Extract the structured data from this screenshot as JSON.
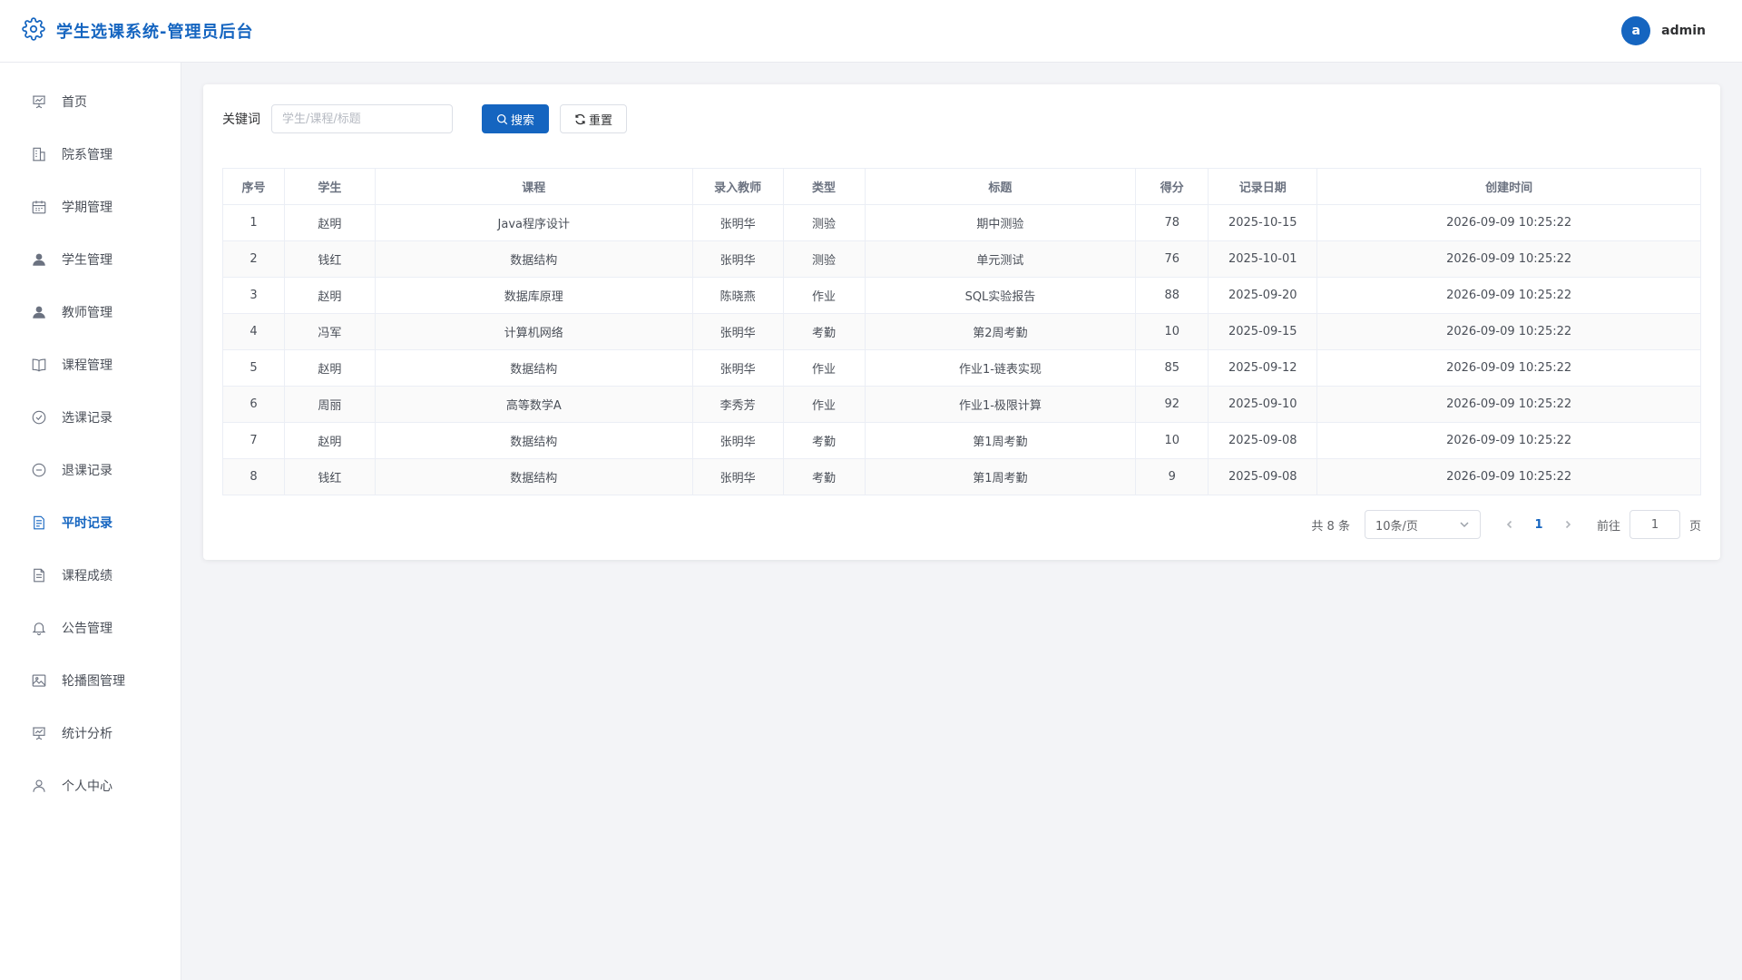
{
  "header": {
    "title": "学生选课系统-管理员后台",
    "avatar_letter": "a",
    "username": "admin"
  },
  "sidebar": {
    "items": [
      {
        "label": "首页",
        "icon": "presentation-icon",
        "active": false
      },
      {
        "label": "院系管理",
        "icon": "building-icon",
        "active": false
      },
      {
        "label": "学期管理",
        "icon": "calendar-icon",
        "active": false
      },
      {
        "label": "学生管理",
        "icon": "user-filled-icon",
        "active": false
      },
      {
        "label": "教师管理",
        "icon": "user-filled-icon",
        "active": false
      },
      {
        "label": "课程管理",
        "icon": "book-icon",
        "active": false
      },
      {
        "label": "选课记录",
        "icon": "circle-check-icon",
        "active": false
      },
      {
        "label": "退课记录",
        "icon": "circle-minus-icon",
        "active": false
      },
      {
        "label": "平时记录",
        "icon": "document-icon",
        "active": true
      },
      {
        "label": "课程成绩",
        "icon": "document-icon",
        "active": false
      },
      {
        "label": "公告管理",
        "icon": "bell-icon",
        "active": false
      },
      {
        "label": "轮播图管理",
        "icon": "picture-icon",
        "active": false
      },
      {
        "label": "统计分析",
        "icon": "presentation-icon",
        "active": false
      },
      {
        "label": "个人中心",
        "icon": "user-outline-icon",
        "active": false
      }
    ]
  },
  "search": {
    "label": "关键词",
    "placeholder": "学生/课程/标题",
    "value": "",
    "search_button": "搜索",
    "reset_button": "重置"
  },
  "table": {
    "columns": [
      "序号",
      "学生",
      "课程",
      "录入教师",
      "类型",
      "标题",
      "得分",
      "记录日期",
      "创建时间"
    ],
    "rows": [
      [
        "1",
        "赵明",
        "Java程序设计",
        "张明华",
        "测验",
        "期中测验",
        "78",
        "2025-10-15",
        "2026-09-09 10:25:22"
      ],
      [
        "2",
        "钱红",
        "数据结构",
        "张明华",
        "测验",
        "单元测试",
        "76",
        "2025-10-01",
        "2026-09-09 10:25:22"
      ],
      [
        "3",
        "赵明",
        "数据库原理",
        "陈晓燕",
        "作业",
        "SQL实验报告",
        "88",
        "2025-09-20",
        "2026-09-09 10:25:22"
      ],
      [
        "4",
        "冯军",
        "计算机网络",
        "张明华",
        "考勤",
        "第2周考勤",
        "10",
        "2025-09-15",
        "2026-09-09 10:25:22"
      ],
      [
        "5",
        "赵明",
        "数据结构",
        "张明华",
        "作业",
        "作业1-链表实现",
        "85",
        "2025-09-12",
        "2026-09-09 10:25:22"
      ],
      [
        "6",
        "周丽",
        "高等数学A",
        "李秀芳",
        "作业",
        "作业1-极限计算",
        "92",
        "2025-09-10",
        "2026-09-09 10:25:22"
      ],
      [
        "7",
        "赵明",
        "数据结构",
        "张明华",
        "考勤",
        "第1周考勤",
        "10",
        "2025-09-08",
        "2026-09-09 10:25:22"
      ],
      [
        "8",
        "钱红",
        "数据结构",
        "张明华",
        "考勤",
        "第1周考勤",
        "9",
        "2025-09-08",
        "2026-09-09 10:25:22"
      ]
    ]
  },
  "pagination": {
    "total": "共 8 条",
    "page_size": "10条/页",
    "current_page": "1",
    "goto_label": "前往",
    "goto_value": "1",
    "goto_suffix": "页"
  },
  "colors": {
    "primary": "#1565c0",
    "background": "#f3f4f7"
  }
}
